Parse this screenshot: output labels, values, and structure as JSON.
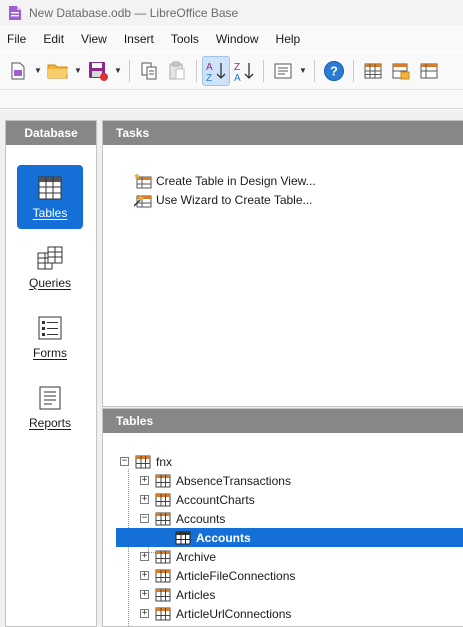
{
  "window": {
    "title": "New Database.odb — LibreOffice Base",
    "app_icon": "libreoffice-base-icon"
  },
  "menu": [
    "File",
    "Edit",
    "View",
    "Insert",
    "Tools",
    "Window",
    "Help"
  ],
  "toolbar": {
    "icons": [
      "new-document-icon",
      "open-folder-icon",
      "save-icon",
      "copy-icon",
      "paste-icon",
      "sort-ascending-icon",
      "sort-descending-icon",
      "form-icon",
      "help-icon",
      "table-icon",
      "table-export-icon",
      "table-grid-icon"
    ],
    "active": "sort-ascending-icon"
  },
  "database_panel": {
    "header": "Database",
    "items": [
      {
        "label": "Tables",
        "icon": "tables-icon",
        "active": true
      },
      {
        "label": "Queries",
        "icon": "queries-icon",
        "active": false
      },
      {
        "label": "Forms",
        "icon": "forms-icon",
        "active": false
      },
      {
        "label": "Reports",
        "icon": "reports-icon",
        "active": false
      }
    ]
  },
  "tasks_panel": {
    "header": "Tasks",
    "items": [
      "Create Table in Design View...",
      "Use Wizard to Create Table..."
    ]
  },
  "tables_panel": {
    "header": "Tables",
    "root": "fnx",
    "items": [
      "AbsenceTransactions",
      "AccountCharts",
      "Accounts",
      "Accounts",
      "Archive",
      "ArticleFileConnections",
      "Articles",
      "ArticleUrlConnections"
    ],
    "selected": "Accounts"
  },
  "colors": {
    "accent": "#1470d6",
    "panel_header": "#878787"
  }
}
